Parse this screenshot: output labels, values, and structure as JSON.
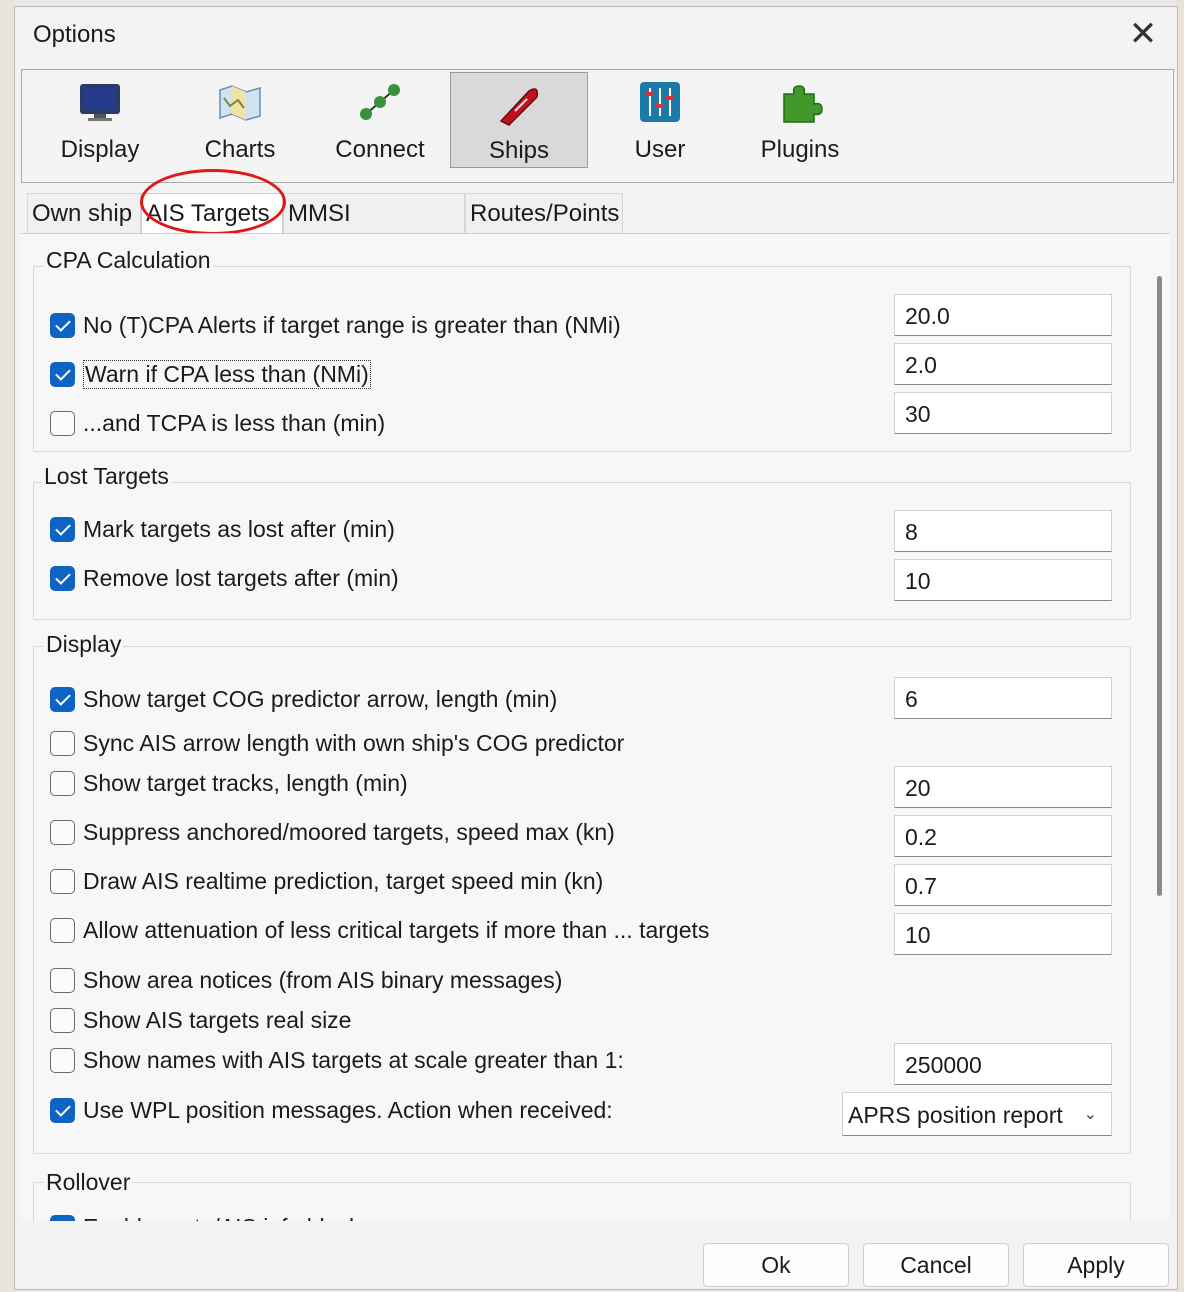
{
  "window": {
    "title": "Options",
    "close_glyph": "✕"
  },
  "toolbar": {
    "items": [
      {
        "label": "Display",
        "icon": "monitor-icon"
      },
      {
        "label": "Charts",
        "icon": "map-icon"
      },
      {
        "label": "Connect",
        "icon": "network-nodes-icon"
      },
      {
        "label": "Ships",
        "icon": "ship-icon",
        "active": true
      },
      {
        "label": "User",
        "icon": "sliders-icon"
      },
      {
        "label": "Plugins",
        "icon": "puzzle-icon"
      }
    ]
  },
  "tabs": [
    "Own ship",
    "AIS Targets",
    "MMSI Properties",
    "Routes/Points"
  ],
  "selected_tab": "AIS Targets",
  "cpa": {
    "title": "CPA Calculation",
    "rows": [
      {
        "label": "No (T)CPA Alerts if target range is greater than (NMi)",
        "checked": true,
        "value": "20.0"
      },
      {
        "label": "Warn if CPA less than (NMi)",
        "checked": true,
        "value": "2.0"
      },
      {
        "label": "...and TCPA is less than (min)",
        "checked": false,
        "value": "30"
      }
    ]
  },
  "lost": {
    "title": "Lost Targets",
    "rows": [
      {
        "label": "Mark targets as lost after (min)",
        "checked": true,
        "value": "8"
      },
      {
        "label": "Remove lost targets after (min)",
        "checked": true,
        "value": "10"
      }
    ]
  },
  "display": {
    "title": "Display",
    "rows": [
      {
        "label": "Show target COG predictor arrow, length (min)",
        "checked": true,
        "value": "6"
      },
      {
        "label": "Sync AIS arrow length with own ship's COG predictor",
        "checked": false
      },
      {
        "label": "Show target tracks, length (min)",
        "checked": false,
        "value": "20"
      },
      {
        "label": "Suppress anchored/moored targets, speed max (kn)",
        "checked": false,
        "value": "0.2"
      },
      {
        "label": "Draw AIS realtime prediction, target speed min (kn)",
        "checked": false,
        "value": "0.7"
      },
      {
        "label": "Allow attenuation of less critical targets if more than ... targets",
        "checked": false,
        "value": "10"
      },
      {
        "label": "Show area notices (from AIS binary messages)",
        "checked": false
      },
      {
        "label": "Show AIS targets real size",
        "checked": false
      },
      {
        "label": "Show names with AIS targets at scale greater than 1:",
        "checked": false,
        "value": "250000"
      },
      {
        "label": "Use WPL position messages. Action when received:",
        "checked": true,
        "select": "APRS position report"
      }
    ]
  },
  "rollover": {
    "title": "Rollover",
    "rows": [
      {
        "label": "Enable route/AIS info block",
        "checked": true
      }
    ]
  },
  "footer": {
    "ok": "Ok",
    "cancel": "Cancel",
    "apply": "Apply"
  },
  "colors": {
    "checkbox_accent": "#0f63c4",
    "annotation_circle": "#e01818"
  }
}
